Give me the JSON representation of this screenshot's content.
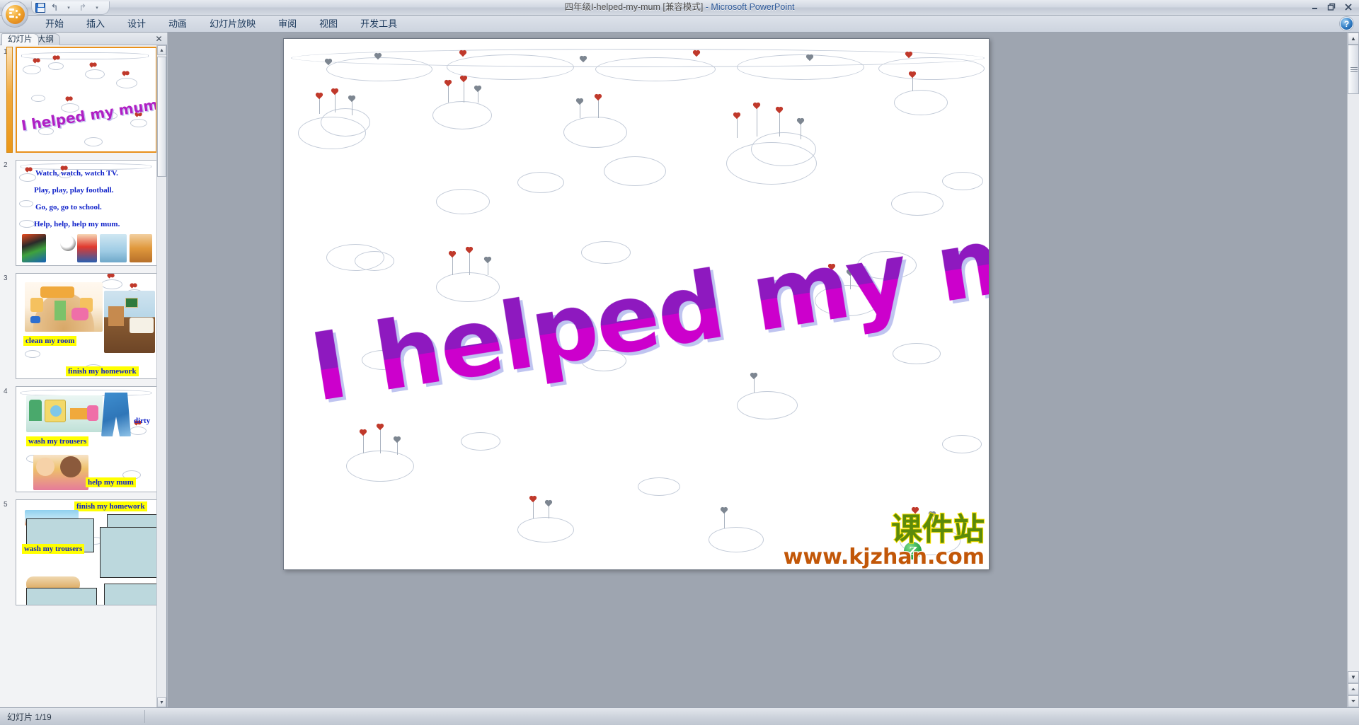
{
  "window": {
    "title_doc": "四年级I-helped-my-mum [兼容模式]",
    "title_sep": " - ",
    "title_app": "Microsoft PowerPoint",
    "minimize": "minimize-glyph",
    "restore": "restore-glyph",
    "close": "close-glyph"
  },
  "quick_access": {
    "office_button": "office-orb",
    "save": "save-icon",
    "undo": "↰",
    "undo_caret": "▾",
    "redo": "↱",
    "customize_caret": "▾"
  },
  "ribbon": {
    "tabs": [
      {
        "label": "开始"
      },
      {
        "label": "插入"
      },
      {
        "label": "设计"
      },
      {
        "label": "动画"
      },
      {
        "label": "幻灯片放映"
      },
      {
        "label": "审阅"
      },
      {
        "label": "视图"
      },
      {
        "label": "开发工具"
      }
    ],
    "help": "?"
  },
  "left_pane": {
    "tabs": [
      {
        "label": "幻灯片",
        "active": true
      },
      {
        "label": "大纲",
        "active": false
      }
    ],
    "close": "✕",
    "scroll_up": "▲",
    "scroll_down": "▼",
    "slides": [
      {
        "number": "1",
        "selected": true,
        "title_word": "I helped my mum.",
        "lines": [],
        "highlights": []
      },
      {
        "number": "2",
        "selected": false,
        "title_word": "",
        "lines": [
          "Watch, watch, watch TV.",
          "Play, play, play football.",
          "Go, go, go to school.",
          "Help, help, help my mum."
        ],
        "highlights": []
      },
      {
        "number": "3",
        "selected": false,
        "title_word": "",
        "lines": [],
        "highlights": [
          "clean my room",
          "finish my homework"
        ]
      },
      {
        "number": "4",
        "selected": false,
        "title_word": "",
        "lines": [
          "dirty"
        ],
        "highlights": [
          "wash my trousers",
          "help my mum"
        ]
      },
      {
        "number": "5",
        "selected": false,
        "title_word": "",
        "lines": [],
        "highlights": [
          "finish my homework",
          "wash my trousers"
        ]
      }
    ]
  },
  "slide": {
    "wordart_text": "I helped my mum.",
    "wordart_color_top": "#8e19bf",
    "wordart_color_bottom": "#cc00cc",
    "wordart_shadow": "#bfc4f0",
    "watermark_cn": "课件站",
    "watermark_url": "www.kjzhan.com",
    "watermark_cn_color": "#5c8a0a",
    "watermark_url_color": "#c25708",
    "z_logo": "Z"
  },
  "workspace_scroll": {
    "up": "▲",
    "down": "▼",
    "prev_slide": "⏶",
    "next_slide": "⏷"
  },
  "status": {
    "slide_counter": "幻灯片 1/19"
  }
}
